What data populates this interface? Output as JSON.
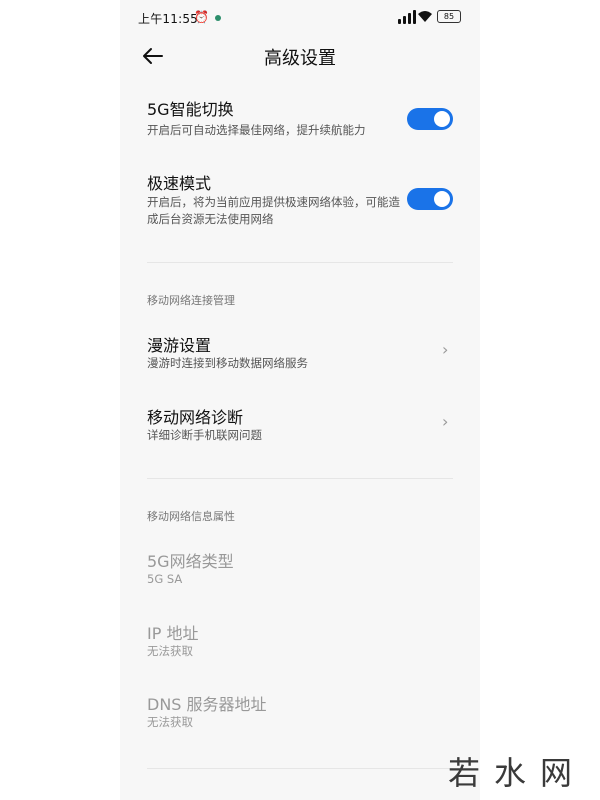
{
  "status_bar": {
    "time": "上午11:55",
    "alarm_icon": "alarm-icon",
    "battery": "85"
  },
  "header": {
    "title": "高级设置",
    "back_icon": "back-arrow-icon"
  },
  "toggles": [
    {
      "title": "5G智能切换",
      "subtitle": "开启后可自动选择最佳网络，提升续航能力",
      "enabled": true
    },
    {
      "title": "极速模式",
      "subtitle": "开启后，将为当前应用提供极速网络体验，可能造成后台资源无法使用网络",
      "enabled": true
    }
  ],
  "sections": {
    "connection_label": "移动网络连接管理",
    "info_label": "移动网络信息属性"
  },
  "nav_items": [
    {
      "title": "漫游设置",
      "subtitle": "漫游时连接到移动数据网络服务"
    },
    {
      "title": "移动网络诊断",
      "subtitle": "详细诊断手机联网问题"
    }
  ],
  "info_items": [
    {
      "title": "5G网络类型",
      "value": "5G SA"
    },
    {
      "title": "IP 地址",
      "value": "无法获取"
    },
    {
      "title": "DNS 服务器地址",
      "value": "无法获取"
    }
  ],
  "watermark": {
    "text": "若水网"
  },
  "colors": {
    "accent": "#1a73e8",
    "background": "#f7f7f7"
  }
}
